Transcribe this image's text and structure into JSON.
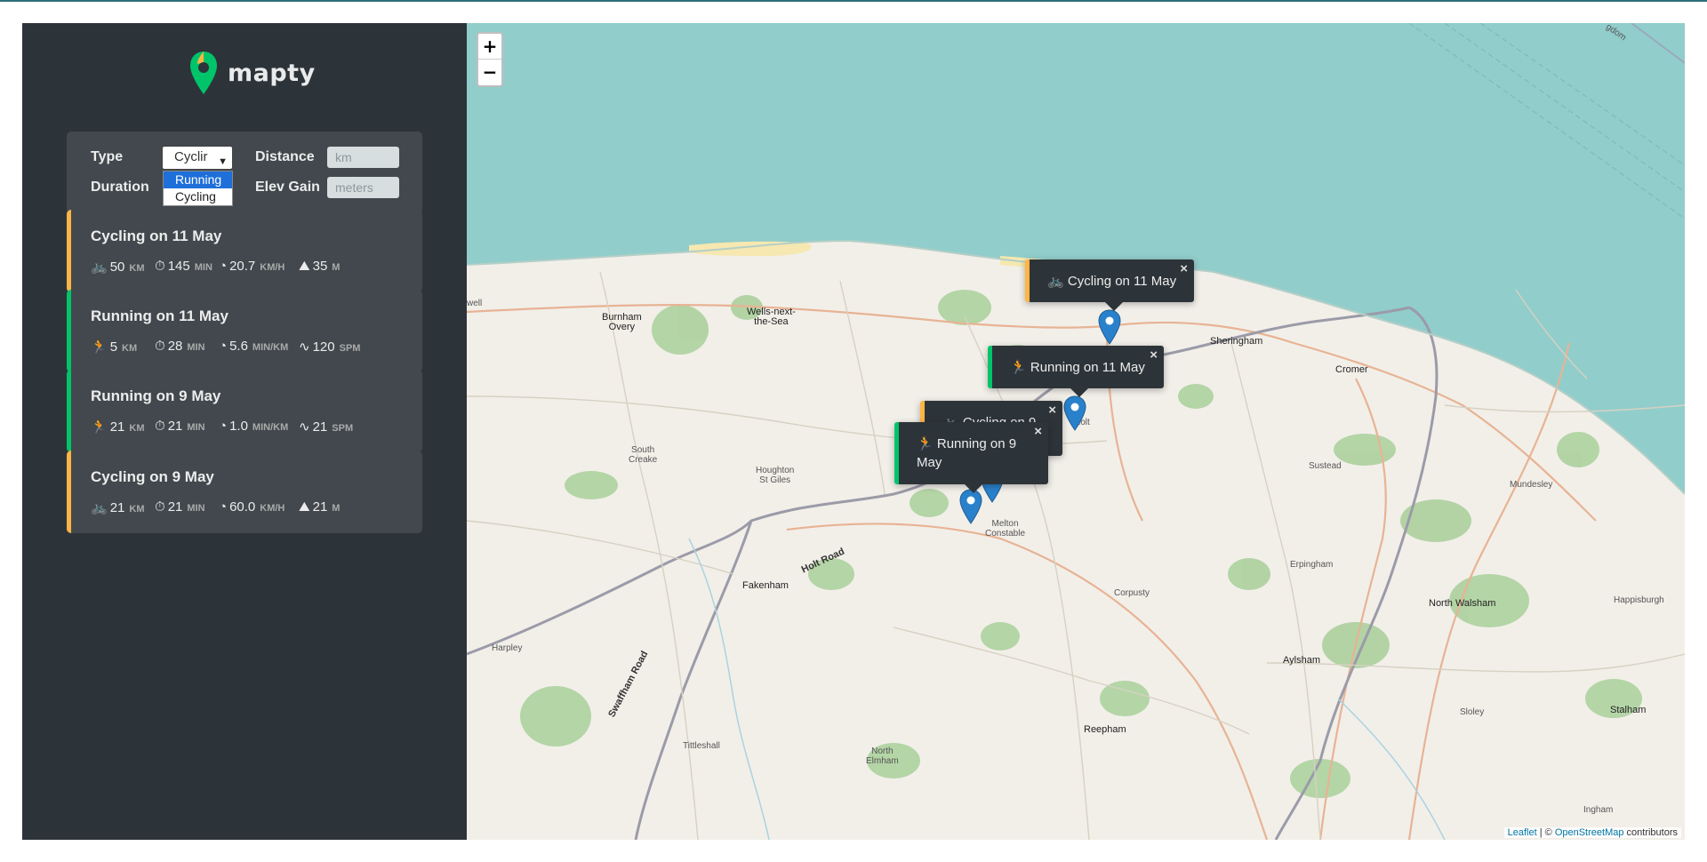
{
  "app": {
    "title": "mapty"
  },
  "form": {
    "type_label": "Type",
    "type_selected": "Cyclir",
    "type_options": [
      "Running",
      "Cycling"
    ],
    "distance_label": "Distance",
    "distance_placeholder": "km",
    "duration_label": "Duration",
    "elev_label": "Elev Gain",
    "elev_placeholder": "meters"
  },
  "workouts": [
    {
      "kind": "cycling",
      "title": "Cycling on 11 May",
      "details": [
        {
          "icon": "bicycle-icon",
          "value": "50",
          "unit": "KM"
        },
        {
          "icon": "stopwatch-icon",
          "value": "145",
          "unit": "MIN"
        },
        {
          "icon": "speedometer-icon",
          "value": "20.7",
          "unit": "KM/H"
        },
        {
          "icon": "mountain-icon",
          "value": "35",
          "unit": "M"
        }
      ]
    },
    {
      "kind": "running",
      "title": "Running on 11 May",
      "details": [
        {
          "icon": "runner-icon",
          "value": "5",
          "unit": "KM"
        },
        {
          "icon": "stopwatch-icon",
          "value": "28",
          "unit": "MIN"
        },
        {
          "icon": "speedometer-icon",
          "value": "5.6",
          "unit": "MIN/KM"
        },
        {
          "icon": "cadence-icon",
          "value": "120",
          "unit": "SPM"
        }
      ]
    },
    {
      "kind": "running",
      "title": "Running on 9 May",
      "details": [
        {
          "icon": "runner-icon",
          "value": "21",
          "unit": "KM"
        },
        {
          "icon": "stopwatch-icon",
          "value": "21",
          "unit": "MIN"
        },
        {
          "icon": "speedometer-icon",
          "value": "1.0",
          "unit": "MIN/KM"
        },
        {
          "icon": "cadence-icon",
          "value": "21",
          "unit": "SPM"
        }
      ]
    },
    {
      "kind": "cycling",
      "title": "Cycling on 9 May",
      "details": [
        {
          "icon": "bicycle-icon",
          "value": "21",
          "unit": "KM"
        },
        {
          "icon": "stopwatch-icon",
          "value": "21",
          "unit": "MIN"
        },
        {
          "icon": "speedometer-icon",
          "value": "60.0",
          "unit": "KM/H"
        },
        {
          "icon": "mountain-icon",
          "value": "21",
          "unit": "M"
        }
      ]
    }
  ],
  "map": {
    "zoom_in": "+",
    "zoom_out": "−",
    "attribution_leaflet": "Leaflet",
    "attribution_sep": " | © ",
    "attribution_osm": "OpenStreetMap",
    "attribution_tail": " contributors",
    "popups": {
      "cycling_11": {
        "label": "Cycling on 11 May",
        "icon": "bicycle-icon"
      },
      "running_11": {
        "label": "Running on 11 May",
        "icon": "runner-icon"
      },
      "cycling_9": {
        "label": "Cycling on 9",
        "icon": "bicycle-icon"
      },
      "running_9_line1": "Running on 9",
      "running_9_line2": "May",
      "running_9_icon": "runner-icon"
    },
    "close_symbol": "×",
    "places": {
      "burnham": "Burnham\nOvery",
      "wells": "Wells-next-\nthe-Sea",
      "well": "well",
      "sheringham": "Sheringham",
      "cromer": "Cromer",
      "south_creake": "South\nCreake",
      "houghton": "Houghton\nSt Giles",
      "melton": "Melton\nConstable",
      "holt": "Holt",
      "holt_road": "Holt Road",
      "fakenham": "Fakenham",
      "sustead": "Sustead",
      "mundesley": "Mundesley",
      "erpingham": "Erpingham",
      "corpusty": "Corpusty",
      "north_walsham": "North Walsham",
      "happisburgh": "Happisburgh",
      "harpley": "Harpley",
      "aylsham": "Aylsham",
      "swaffham_road": "Swaffham Road",
      "reepham": "Reepham",
      "sloley": "Sloley",
      "stalham": "Stalham",
      "tittleshall": "Tittleshall",
      "north_elmham": "North\nElmham",
      "ingham": "Ingham",
      "kingdom": "gdom"
    }
  }
}
